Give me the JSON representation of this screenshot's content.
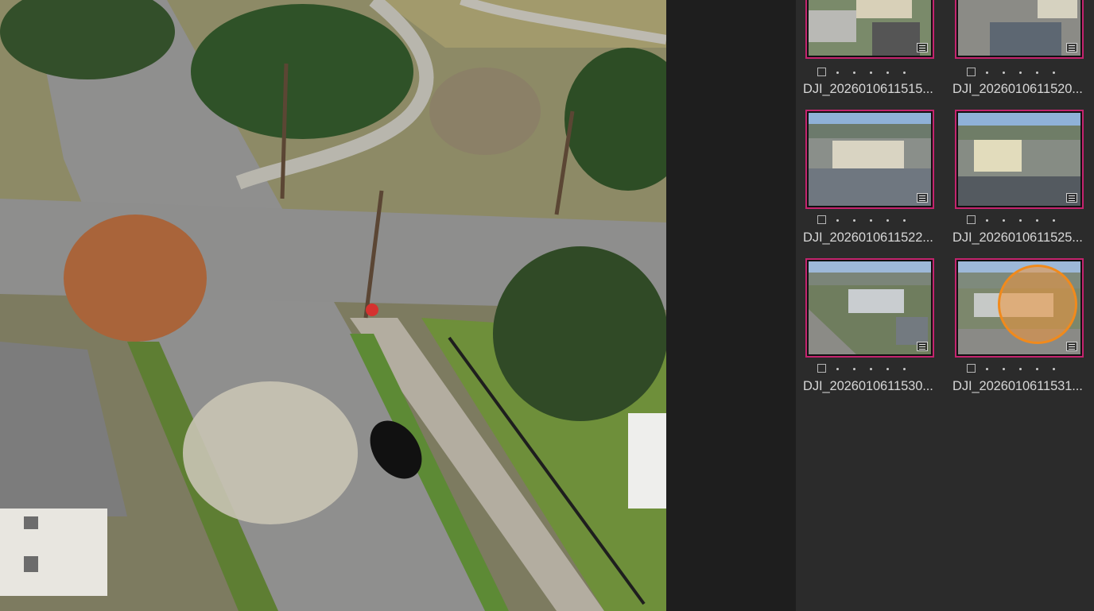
{
  "preview": {
    "description_icon": "aerial-photo"
  },
  "filmstrip": {
    "accent_border": "#c4246e",
    "items": [
      {
        "filename": "DJI_2026010611515...",
        "rating_dots": 5
      },
      {
        "filename": "DJI_2026010611520...",
        "rating_dots": 5
      },
      {
        "filename": "DJI_2026010611522...",
        "rating_dots": 5
      },
      {
        "filename": "DJI_2026010611525...",
        "rating_dots": 5
      },
      {
        "filename": "DJI_2026010611530...",
        "rating_dots": 5
      },
      {
        "filename": "DJI_2026010611531...",
        "rating_dots": 5
      }
    ],
    "cursor_highlight_color": "#f18a1c"
  }
}
